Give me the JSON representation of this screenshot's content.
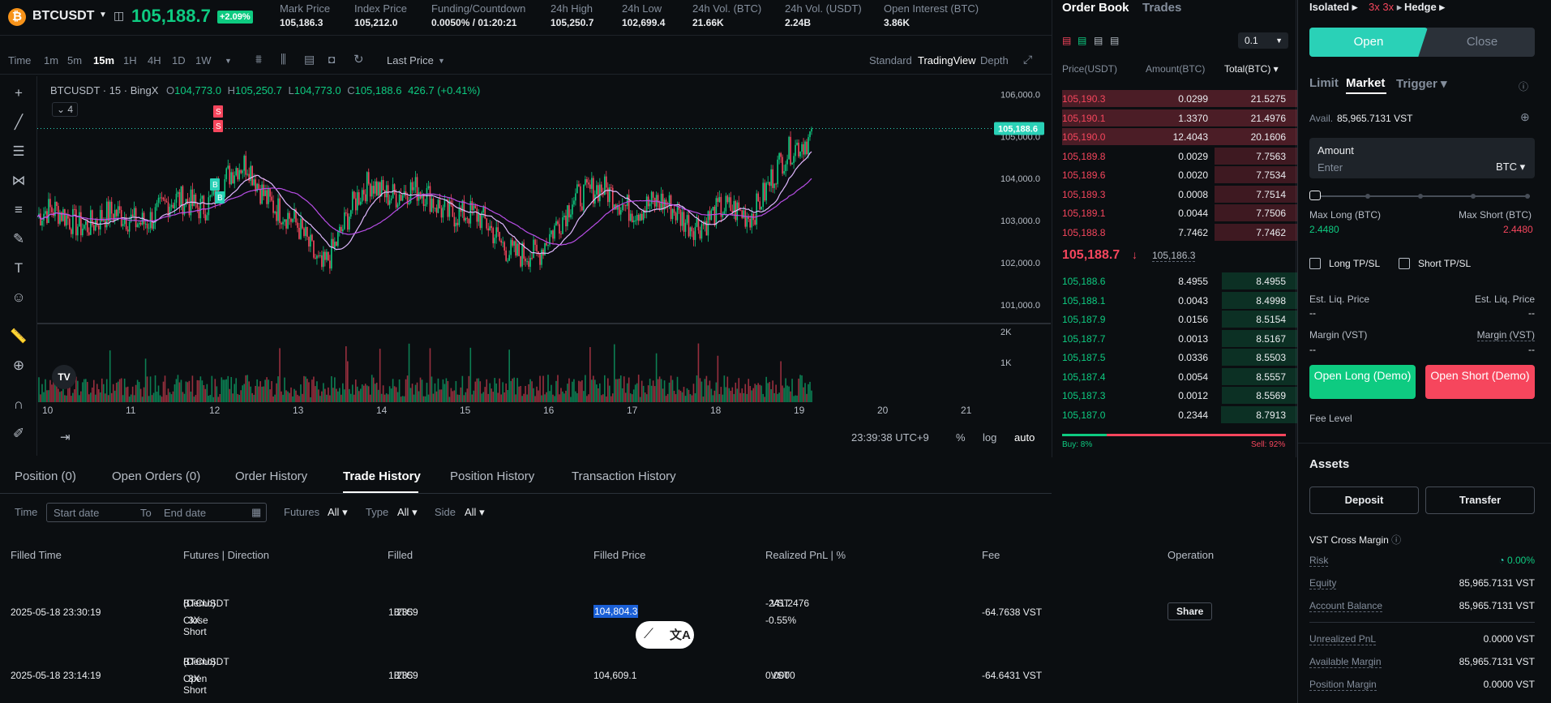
{
  "header": {
    "symbol": "BTCUSDT",
    "price": "105,188.7",
    "change": "+2.09%",
    "stats": [
      {
        "label": "Mark Price",
        "value": "105,186.3"
      },
      {
        "label": "Index Price",
        "value": "105,212.0"
      },
      {
        "label": "Funding/Countdown",
        "value": "0.0050% / 01:20:21"
      },
      {
        "label": "24h High",
        "value": "105,250.7"
      },
      {
        "label": "24h Low",
        "value": "102,699.4"
      },
      {
        "label": "24h Vol. (BTC)",
        "value": "21.66K"
      },
      {
        "label": "24h Vol. (USDT)",
        "value": "2.24B"
      },
      {
        "label": "Open Interest (BTC)",
        "value": "3.86K"
      }
    ]
  },
  "chart_toolbar": {
    "intervals": [
      "Time",
      "1m",
      "5m",
      "15m",
      "1H",
      "4H",
      "1D",
      "1W"
    ],
    "active_interval": "15m",
    "price_type": "Last Price",
    "views": [
      "Standard",
      "TradingView",
      "Depth"
    ],
    "active_view": "TradingView"
  },
  "chart": {
    "legend_symbol": "BTCUSDT · 15 · BingX",
    "o": "104,773.0",
    "h": "105,250.7",
    "l": "104,773.0",
    "c": "105,188.6",
    "chg": "426.7 (+0.41%)",
    "indicator_count": "4",
    "price_tag": "105,188.6",
    "y_ticks": [
      "106,000.0",
      "105,000.0",
      "104,000.0",
      "103,000.0",
      "102,000.0",
      "101,000.0"
    ],
    "y_values": [
      106000,
      105000,
      104000,
      103000,
      102000,
      101000
    ],
    "vol_ticks": [
      "2K",
      "1K"
    ],
    "x_ticks": [
      "10",
      "11",
      "12",
      "13",
      "14",
      "15",
      "16",
      "17",
      "18",
      "19",
      "20",
      "21"
    ],
    "markers": [
      "S",
      "S",
      "B",
      "B"
    ],
    "clock": "23:39:38 UTC+9",
    "scale_opts": [
      "%",
      "log",
      "auto"
    ]
  },
  "chart_data": {
    "type": "line",
    "x": [
      "10",
      "11",
      "12",
      "12.5",
      "13",
      "13.5",
      "14",
      "15",
      "16",
      "16.5",
      "17",
      "18",
      "18.5",
      "19"
    ],
    "series": [
      {
        "name": "BTCUSDT",
        "values": [
          103100,
          103000,
          103500,
          104300,
          103000,
          102000,
          103900,
          103300,
          102000,
          103700,
          103500,
          103000,
          103300,
          105188
        ]
      }
    ],
    "ylim": [
      100500,
      106200
    ]
  },
  "orderbook": {
    "tabs": [
      "Order Book",
      "Trades"
    ],
    "step": "0.1",
    "cols": [
      "Price(USDT)",
      "Amount(BTC)",
      "Total(BTC)"
    ],
    "asks": [
      {
        "p": "105,190.3",
        "a": "0.0299",
        "t": "21.5275"
      },
      {
        "p": "105,190.1",
        "a": "1.3370",
        "t": "21.4976"
      },
      {
        "p": "105,190.0",
        "a": "12.4043",
        "t": "20.1606"
      },
      {
        "p": "105,189.8",
        "a": "0.0029",
        "t": "7.7563"
      },
      {
        "p": "105,189.6",
        "a": "0.0020",
        "t": "7.7534"
      },
      {
        "p": "105,189.3",
        "a": "0.0008",
        "t": "7.7514"
      },
      {
        "p": "105,189.1",
        "a": "0.0044",
        "t": "7.7506"
      },
      {
        "p": "105,188.8",
        "a": "7.7462",
        "t": "7.7462"
      }
    ],
    "mid": "105,188.7",
    "mark": "105,186.3",
    "bids": [
      {
        "p": "105,188.6",
        "a": "8.4955",
        "t": "8.4955"
      },
      {
        "p": "105,188.1",
        "a": "0.0043",
        "t": "8.4998"
      },
      {
        "p": "105,187.9",
        "a": "0.0156",
        "t": "8.5154"
      },
      {
        "p": "105,187.7",
        "a": "0.0013",
        "t": "8.5167"
      },
      {
        "p": "105,187.5",
        "a": "0.0336",
        "t": "8.5503"
      },
      {
        "p": "105,187.4",
        "a": "0.0054",
        "t": "8.5557"
      },
      {
        "p": "105,187.3",
        "a": "0.0012",
        "t": "8.5569"
      },
      {
        "p": "105,187.0",
        "a": "0.2344",
        "t": "8.7913"
      }
    ],
    "buy_pct": "Buy: 8%",
    "sell_pct": "Sell: 92%",
    "buy_ratio": 0.08
  },
  "bottom": {
    "tabs": [
      "Position (0)",
      "Open Orders (0)",
      "Order History",
      "Trade History",
      "Position History",
      "Transaction History"
    ],
    "active_tab": "Trade History",
    "filters": {
      "time": "Time",
      "start": "Start date",
      "to": "To",
      "end": "End date",
      "futures": "Futures",
      "type": "Type",
      "side": "Side",
      "all": "All"
    },
    "cols": [
      "Filled Time",
      "Futures | Direction",
      "Filled",
      "Filled Price",
      "Realized PnL | %",
      "Fee",
      "Operation"
    ],
    "rows": [
      {
        "time": "2025-05-18 23:30:19",
        "sym": "BTCUSDT",
        "demo": "(Demo)",
        "dir": "Close Short",
        "lev": "3X",
        "filled": "1.2359",
        "unit": "BTC",
        "price": "104,804.3",
        "pnl": "-241.2476",
        "pnl_unit": "VST",
        "pct": "-0.55%",
        "fee": "-64.7638 VST",
        "op": "Share"
      },
      {
        "time": "2025-05-18 23:14:19",
        "sym": "BTCUSDT",
        "demo": "(Demo)",
        "dir": "Open Short",
        "lev": "3X",
        "filled": "1.2359",
        "unit": "BTC",
        "price": "104,609.1",
        "pnl": "0.0000",
        "pnl_unit": "VST",
        "fee": "-64.6431 VST"
      }
    ]
  },
  "trade": {
    "margin_mode": "Isolated",
    "leverage": "3x 3x",
    "position_mode": "Hedge",
    "open": "Open",
    "close": "Close",
    "order_types": [
      "Limit",
      "Market",
      "Trigger"
    ],
    "active_type": "Market",
    "avail_label": "Avail.",
    "avail_value": "85,965.7131 VST",
    "amount_label": "Amount",
    "amount_placeholder": "Enter",
    "amount_unit": "BTC",
    "max_long_label": "Max Long (BTC)",
    "max_long": "2.4480",
    "max_short_label": "Max Short (BTC)",
    "max_short": "2.4480",
    "long_tpsl": "Long TP/SL",
    "short_tpsl": "Short TP/SL",
    "liq_label": "Est. Liq. Price",
    "margin_label": "Margin (VST)",
    "dash": "--",
    "open_long": "Open Long (Demo)",
    "open_short": "Open Short (Demo)",
    "fee_level": "Fee Level",
    "assets": "Assets",
    "deposit": "Deposit",
    "transfer": "Transfer",
    "cross_margin": "VST Cross Margin",
    "risk_label": "Risk",
    "risk": "0.00%",
    "equity_label": "Equity",
    "equity": "85,965.7131 VST",
    "balance_label": "Account Balance",
    "balance": "85,965.7131 VST",
    "upnl_label": "Unrealized PnL",
    "upnl": "0.0000 VST",
    "avail_margin_label": "Available Margin",
    "avail_margin": "85,965.7131 VST",
    "pos_margin_label": "Position Margin",
    "pos_margin": "0.0000 VST"
  },
  "colors": {
    "up": "#0ecb81",
    "down": "#f6465d",
    "accent": "#2ad1b7",
    "ma1": "#e0b8ff",
    "ma2": "#b84de6"
  }
}
